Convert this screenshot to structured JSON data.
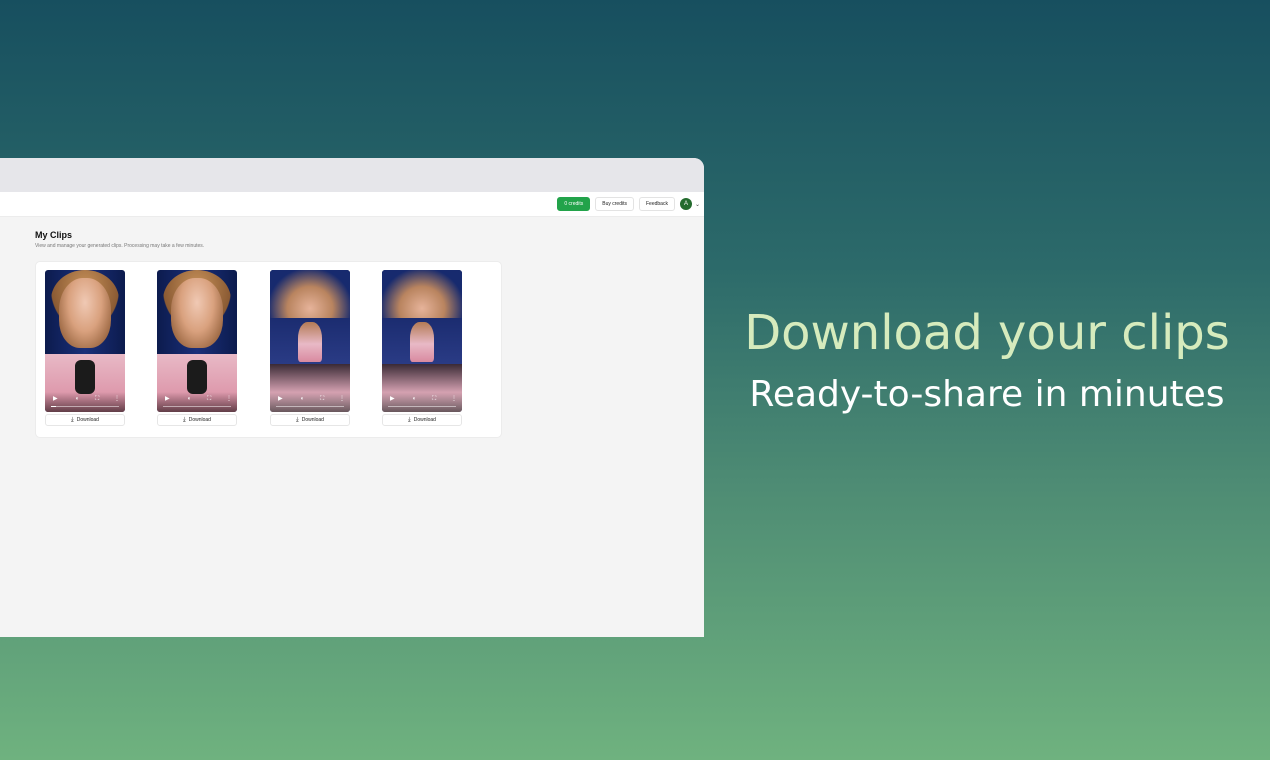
{
  "header": {
    "credits_label": "0 credits",
    "buy_credits_label": "Buy credits",
    "feedback_label": "Feedback",
    "avatar_initial": "A",
    "chevron": "⌄"
  },
  "main": {
    "title": "My Clips",
    "subtitle": "View and manage your generated clips. Processing may take a few minutes."
  },
  "clips": [
    {
      "download_label": "Download",
      "progress": 0.08
    },
    {
      "download_label": "Download",
      "progress": 0.0
    },
    {
      "download_label": "Download",
      "progress": 0.0
    },
    {
      "download_label": "Download",
      "progress": 0.0
    }
  ],
  "video_controls": {
    "play_icon": "play-icon",
    "volume_icon": "volume-icon",
    "fullscreen_icon": "fullscreen-icon",
    "more_icon": "more-icon"
  },
  "promo": {
    "headline": "Download your clips",
    "subline": "Ready-to-share in minutes"
  },
  "colors": {
    "credits_green": "#22a34a",
    "headline_color": "#d6ebbd",
    "avatar_green": "#246b2e"
  }
}
